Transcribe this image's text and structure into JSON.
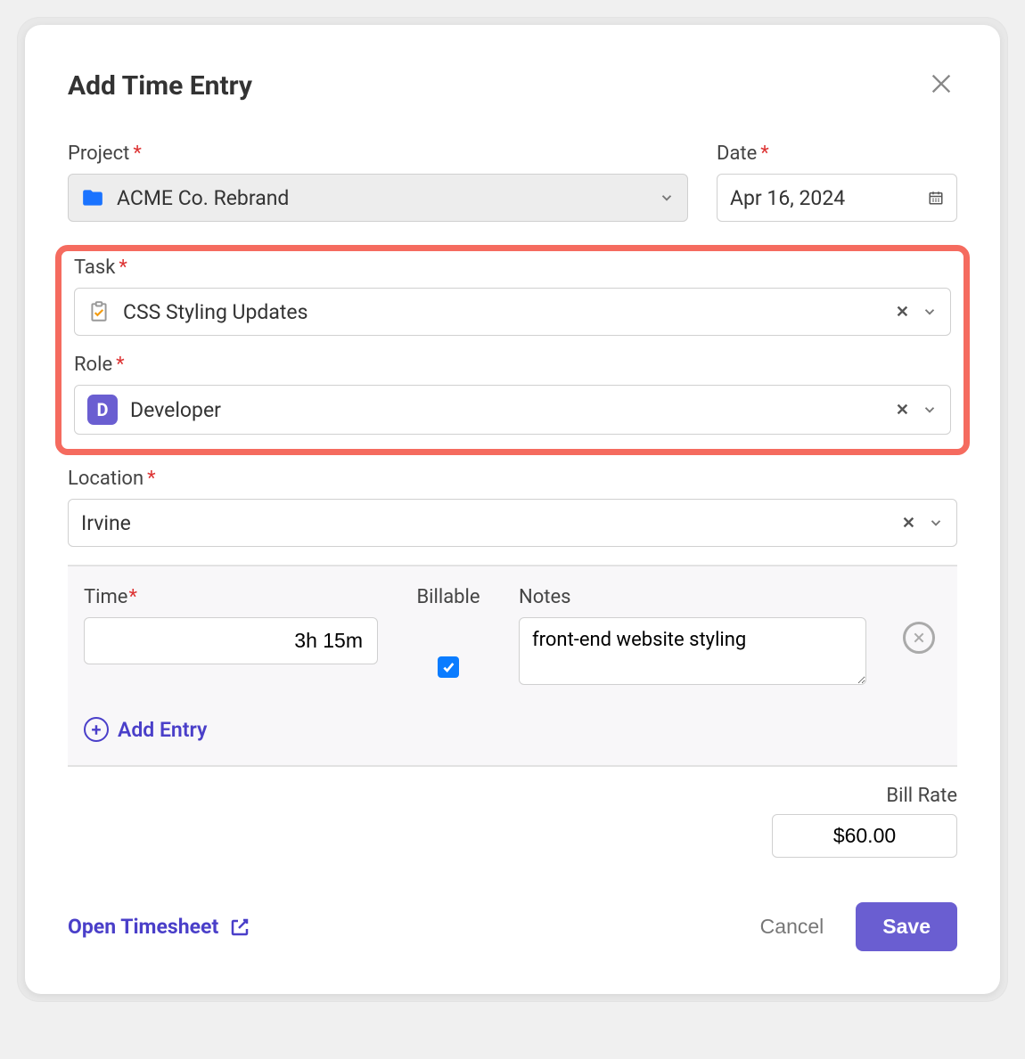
{
  "dialog": {
    "title": "Add Time Entry"
  },
  "project": {
    "label": "Project",
    "value": "ACME Co. Rebrand"
  },
  "date": {
    "label": "Date",
    "value": "Apr 16, 2024"
  },
  "task": {
    "label": "Task",
    "value": "CSS Styling Updates"
  },
  "role": {
    "label": "Role",
    "value": "Developer",
    "badge": "D"
  },
  "location": {
    "label": "Location",
    "value": "Irvine"
  },
  "time": {
    "time_label": "Time",
    "billable_label": "Billable",
    "notes_label": "Notes",
    "entries": [
      {
        "time": "3h 15m",
        "billable": true,
        "notes": "front-end website styling"
      }
    ],
    "add_entry_label": "Add Entry"
  },
  "billrate": {
    "label": "Bill Rate",
    "value": "$60.00"
  },
  "footer": {
    "open_timesheet": "Open Timesheet",
    "cancel": "Cancel",
    "save": "Save"
  }
}
